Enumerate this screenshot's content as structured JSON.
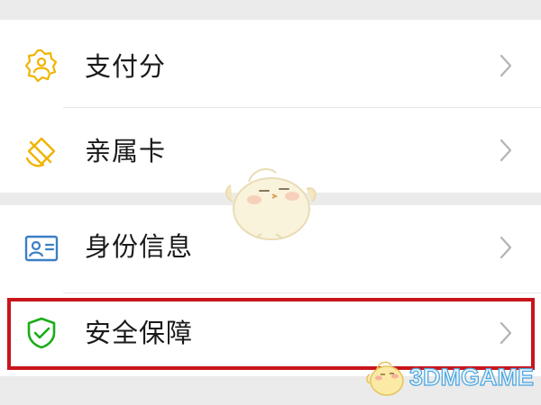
{
  "menu": {
    "items": [
      {
        "label": "支付分",
        "icon": "payscore-badge-icon"
      },
      {
        "label": "亲属卡",
        "icon": "family-card-icon"
      },
      {
        "label": "身份信息",
        "icon": "id-card-icon"
      },
      {
        "label": "安全保障",
        "icon": "shield-check-icon"
      }
    ]
  },
  "watermark": {
    "text": "3DMGAME"
  },
  "colors": {
    "yellow_icon": "#f0b400",
    "blue_icon": "#3b7fc4",
    "green_icon": "#1aad19",
    "highlight": "#c8151b",
    "section_gap": "#ebebeb"
  }
}
